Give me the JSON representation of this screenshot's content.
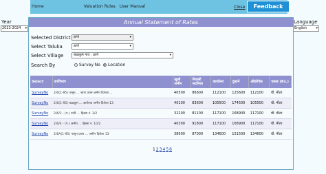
{
  "nav": {
    "home": "Home",
    "valuation_rules": "Valuation Rules",
    "user_manual": "User Manual",
    "close": "Close",
    "feedback": "Feedback"
  },
  "year": {
    "label": "Year",
    "selected": "2023-2024"
  },
  "language": {
    "label": "Language",
    "selected": "English"
  },
  "panel_title": "Annual Statement of Rates",
  "form": {
    "district_label": "Selected District",
    "district_value": "ठाणे",
    "taluka_label": "Select Taluka",
    "taluka_value": "ठाणे",
    "village_label": "Select Village",
    "village_value": "बाळकुम गाव : ठाणे",
    "search_by_label": "Search By",
    "option_survey": "Survey No",
    "option_location": "Location",
    "selected_option": "Location"
  },
  "table": {
    "headers": [
      "Select",
      "उपविभाग",
      "खुली जमीन",
      "निवासी सदनिका",
      "कार्यालय",
      "दुकाने",
      "औद्योगीक",
      "एकक (Rs.)"
    ],
    "rows": [
      {
        "select": "SurveyNo",
        "desc": "2/6(1-95) पासून ... जागा प्रथम जमीन दिलेला ...",
        "c1": "40500",
        "c2": "86600",
        "c3": "112100",
        "c4": "125600",
        "c5": "112100",
        "unit": "चौ. मीटर"
      },
      {
        "select": "SurveyNo",
        "desc": "2/6(1-95) बाळकुम ... आलेल्या जमीन दिलेला 13",
        "c1": "40100",
        "c2": "83600",
        "c3": "105500",
        "c4": "174500",
        "c5": "105500",
        "unit": "चौ. मीटर"
      },
      {
        "select": "SurveyNo",
        "desc": "2/6/3 - (प.) यांनी ... हिस्सा नं. 3/2",
        "c1": "32200",
        "c2": "81100",
        "c3": "117100",
        "c4": "168900",
        "c5": "117100",
        "unit": "चौ. मीटर"
      },
      {
        "select": "SurveyNo",
        "desc": "2/6/4 - (प.) जमीन ... हिस्सा नं. 10/2",
        "c1": "40300",
        "c2": "91800",
        "c3": "117100",
        "c4": "168900",
        "c5": "117100",
        "unit": "चौ. मीटर"
      },
      {
        "select": "SurveyNo",
        "desc": "2/6A(1-95) पासून प्रथम ... जमीन दिलेला 13",
        "c1": "38600",
        "c2": "87000",
        "c3": "134600",
        "c4": "151500",
        "c5": "134600",
        "unit": "चौ. मीटर"
      }
    ]
  },
  "pager": {
    "pages": [
      "1",
      "2",
      "3",
      "4",
      "5",
      "6"
    ],
    "current": "1"
  }
}
